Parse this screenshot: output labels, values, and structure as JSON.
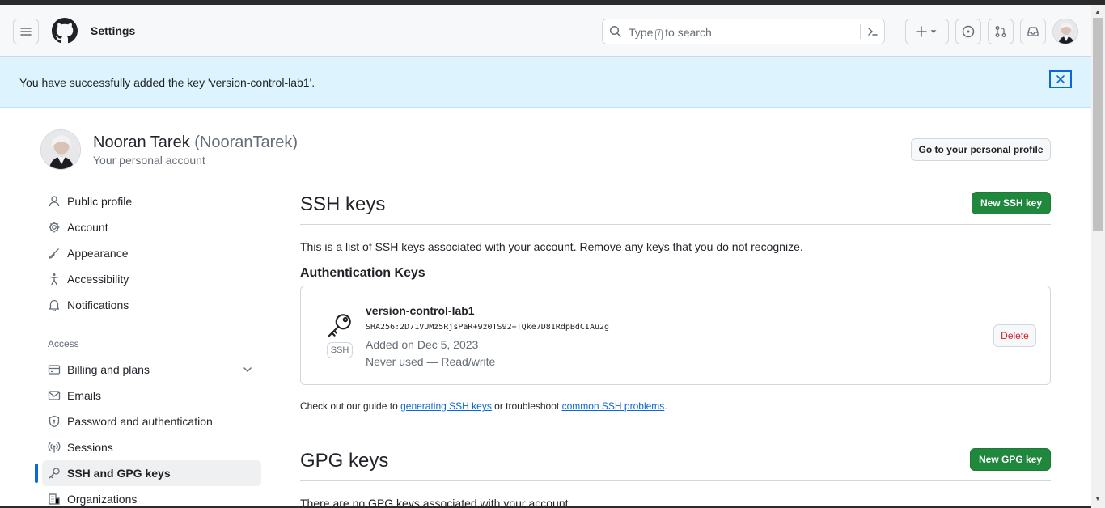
{
  "header": {
    "title": "Settings",
    "search_prefix": "Type",
    "search_key": "/",
    "search_suffix": "to search"
  },
  "flash": {
    "message": "You have successfully added the key 'version-control-lab1'."
  },
  "account": {
    "name": "Nooran Tarek",
    "login": "(NooranTarek)",
    "subtitle": "Your personal account",
    "profile_button": "Go to your personal profile"
  },
  "sidebar": {
    "items": [
      {
        "label": "Public profile",
        "icon": "person-icon"
      },
      {
        "label": "Account",
        "icon": "gear-icon"
      },
      {
        "label": "Appearance",
        "icon": "paintbrush-icon"
      },
      {
        "label": "Accessibility",
        "icon": "accessibility-icon"
      },
      {
        "label": "Notifications",
        "icon": "bell-icon"
      }
    ],
    "access_heading": "Access",
    "access_items": [
      {
        "label": "Billing and plans",
        "icon": "credit-card-icon"
      },
      {
        "label": "Emails",
        "icon": "mail-icon"
      },
      {
        "label": "Password and authentication",
        "icon": "shield-lock-icon"
      },
      {
        "label": "Sessions",
        "icon": "broadcast-icon"
      },
      {
        "label": "SSH and GPG keys",
        "icon": "key-icon",
        "active": true
      },
      {
        "label": "Organizations",
        "icon": "organization-icon"
      }
    ]
  },
  "ssh": {
    "title": "SSH keys",
    "new_button": "New SSH key",
    "description": "This is a list of SSH keys associated with your account. Remove any keys that you do not recognize.",
    "auth_heading": "Authentication Keys",
    "key": {
      "name": "version-control-lab1",
      "fingerprint": "SHA256:2D71VUMz5RjsPaR+9z0TS92+TQke7D81RdpBdCIAu2g",
      "added": "Added on Dec 5, 2023",
      "usage": "Never used — Read/write",
      "type_label": "SSH",
      "delete_label": "Delete"
    },
    "guide_prefix": "Check out our guide to",
    "guide_link1": "generating SSH keys",
    "guide_middle": "or troubleshoot",
    "guide_link2": "common SSH problems",
    "guide_suffix": "."
  },
  "gpg": {
    "title": "GPG keys",
    "new_button": "New GPG key",
    "description": "There are no GPG keys associated with your account."
  },
  "colors": {
    "accent": "#0969da",
    "primary_button": "#1f883d",
    "flash_bg": "#ddf4ff",
    "danger": "#cf222e"
  }
}
